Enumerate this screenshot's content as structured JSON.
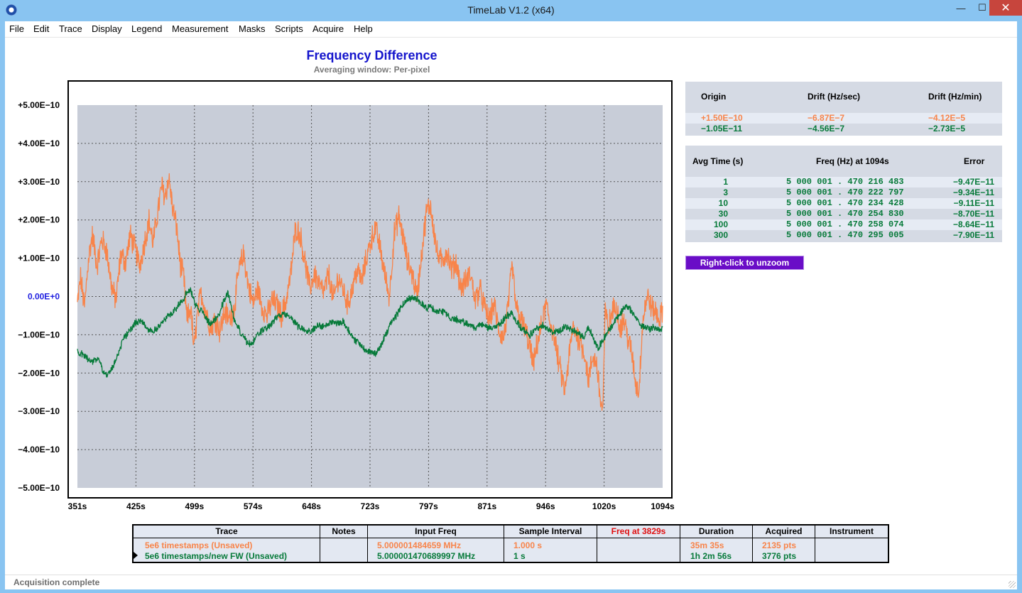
{
  "window": {
    "title": "TimeLab V1.2 (x64)",
    "min_glyph": "—",
    "max_glyph": "☐",
    "close_glyph": "✕"
  },
  "menu": [
    "File",
    "Edit",
    "Trace",
    "Display",
    "Legend",
    "Measurement",
    "Masks",
    "Scripts",
    "Acquire",
    "Help"
  ],
  "chart_title": "Frequency Difference",
  "chart_subtitle": "Averaging window: Per-pixel",
  "colors": {
    "series1": "#f8844a",
    "series2": "#077a3a",
    "plot_bg": "#c8cdd8",
    "zero_label": "#2020e0",
    "title": "#1414cc",
    "unzoom_bg": "#6a0dc7",
    "freq_header": "#e01010"
  },
  "chart_data": {
    "type": "line",
    "xlabel": "",
    "ylabel": "",
    "xlim": [
      351,
      1094
    ],
    "ylim": [
      -5e-10,
      5e-10
    ],
    "grid": true,
    "x_ticks": [
      "351s",
      "425s",
      "499s",
      "574s",
      "648s",
      "723s",
      "797s",
      "871s",
      "946s",
      "1020s",
      "1094s"
    ],
    "y_ticks": [
      "+5.00E−10",
      "+4.00E−10",
      "+3.00E−10",
      "+2.00E−10",
      "+1.00E−10",
      "0.00E+0",
      "−1.00E−10",
      "−2.00E−10",
      "−3.00E−10",
      "−4.00E−10",
      "−5.00E−10"
    ],
    "series": [
      {
        "name": "5e6 timestamps (Unsaved)",
        "color": "#f8844a",
        "noise": 0.28,
        "points": [
          [
            351,
            -0.2
          ],
          [
            355,
            0.5
          ],
          [
            360,
            -0.3
          ],
          [
            365,
            1.0
          ],
          [
            370,
            1.6
          ],
          [
            376,
            0.8
          ],
          [
            382,
            1.5
          ],
          [
            388,
            1.2
          ],
          [
            395,
            0.2
          ],
          [
            400,
            -0.1
          ],
          [
            406,
            1.1
          ],
          [
            412,
            0.9
          ],
          [
            418,
            1.6
          ],
          [
            425,
            1.2
          ],
          [
            430,
            0.8
          ],
          [
            436,
            1.4
          ],
          [
            442,
            2.0
          ],
          [
            447,
            1.4
          ],
          [
            453,
            2.2
          ],
          [
            458,
            2.9
          ],
          [
            462,
            2.6
          ],
          [
            467,
            3.1
          ],
          [
            472,
            2.3
          ],
          [
            477,
            1.8
          ],
          [
            482,
            0.8
          ],
          [
            486,
            0.5
          ],
          [
            490,
            -0.6
          ],
          [
            495,
            -0.3
          ],
          [
            499,
            -1.4
          ],
          [
            503,
            -0.5
          ],
          [
            508,
            0.1
          ],
          [
            514,
            -0.4
          ],
          [
            520,
            -0.8
          ],
          [
            526,
            -0.6
          ],
          [
            532,
            -0.9
          ],
          [
            538,
            -0.4
          ],
          [
            544,
            -0.6
          ],
          [
            550,
            -0.3
          ],
          [
            556,
            0.7
          ],
          [
            562,
            1.1
          ],
          [
            568,
            0.3
          ],
          [
            574,
            -0.2
          ],
          [
            580,
            0.2
          ],
          [
            586,
            -0.3
          ],
          [
            592,
            -0.5
          ],
          [
            598,
            -0.1
          ],
          [
            604,
            -0.2
          ],
          [
            610,
            -0.5
          ],
          [
            616,
            -0.1
          ],
          [
            622,
            0.6
          ],
          [
            628,
            1.8
          ],
          [
            634,
            1.6
          ],
          [
            640,
            0.9
          ],
          [
            646,
            0.2
          ],
          [
            652,
            0.6
          ],
          [
            658,
            0.3
          ],
          [
            664,
            0.1
          ],
          [
            670,
            0.6
          ],
          [
            676,
            -0.1
          ],
          [
            682,
            0.5
          ],
          [
            688,
            0.2
          ],
          [
            694,
            -0.2
          ],
          [
            700,
            0.2
          ],
          [
            706,
            0.7
          ],
          [
            712,
            0.4
          ],
          [
            718,
            1.0
          ],
          [
            723,
            1.4
          ],
          [
            729,
            1.8
          ],
          [
            735,
            1.3
          ],
          [
            741,
            0.6
          ],
          [
            747,
            0.0
          ],
          [
            753,
            1.6
          ],
          [
            759,
            2.1
          ],
          [
            765,
            1.5
          ],
          [
            770,
            0.9
          ],
          [
            776,
            0.6
          ],
          [
            782,
            0.0
          ],
          [
            788,
            1.1
          ],
          [
            794,
            2.2
          ],
          [
            799,
            2.4
          ],
          [
            803,
            1.8
          ],
          [
            808,
            1.1
          ],
          [
            814,
            0.9
          ],
          [
            820,
            1.2
          ],
          [
            826,
            0.7
          ],
          [
            832,
            0.9
          ],
          [
            838,
            0.2
          ],
          [
            844,
            0.4
          ],
          [
            850,
            0.6
          ],
          [
            856,
            -0.1
          ],
          [
            862,
            0.2
          ],
          [
            868,
            -0.3
          ],
          [
            874,
            -0.6
          ],
          [
            880,
            -0.2
          ],
          [
            886,
            -0.9
          ],
          [
            892,
            -1.1
          ],
          [
            897,
            -0.4
          ],
          [
            903,
            0.8
          ],
          [
            908,
            -0.3
          ],
          [
            914,
            -0.6
          ],
          [
            920,
            -0.9
          ],
          [
            925,
            -1.3
          ],
          [
            930,
            -1.8
          ],
          [
            935,
            -1.2
          ],
          [
            940,
            -0.8
          ],
          [
            946,
            -0.2
          ],
          [
            950,
            -0.6
          ],
          [
            955,
            -0.9
          ],
          [
            960,
            -1.5
          ],
          [
            965,
            -2.0
          ],
          [
            970,
            -2.5
          ],
          [
            975,
            -1.6
          ],
          [
            980,
            -0.8
          ],
          [
            985,
            -1.0
          ],
          [
            990,
            -1.2
          ],
          [
            995,
            -1.5
          ],
          [
            1000,
            -2.2
          ],
          [
            1005,
            -1.6
          ],
          [
            1010,
            -1.7
          ],
          [
            1015,
            -2.7
          ],
          [
            1018,
            -3.0
          ],
          [
            1021,
            -0.4
          ],
          [
            1025,
            -0.8
          ],
          [
            1030,
            -0.4
          ],
          [
            1035,
            -0.2
          ],
          [
            1040,
            -0.8
          ],
          [
            1045,
            -0.6
          ],
          [
            1050,
            -1.1
          ],
          [
            1055,
            -1.5
          ],
          [
            1060,
            -2.3
          ],
          [
            1064,
            -2.5
          ],
          [
            1068,
            -0.8
          ],
          [
            1072,
            -0.2
          ],
          [
            1076,
            0.0
          ],
          [
            1080,
            -0.3
          ],
          [
            1085,
            -0.4
          ],
          [
            1090,
            -0.6
          ],
          [
            1094,
            -0.4
          ]
        ]
      },
      {
        "name": "5e6 timestamps/new FW (Unsaved)",
        "color": "#077a3a",
        "noise": 0.08,
        "points": [
          [
            351,
            -1.45
          ],
          [
            360,
            -1.55
          ],
          [
            370,
            -1.7
          ],
          [
            378,
            -1.6
          ],
          [
            384,
            -2.0
          ],
          [
            390,
            -2.05
          ],
          [
            398,
            -1.75
          ],
          [
            404,
            -1.4
          ],
          [
            410,
            -1.1
          ],
          [
            418,
            -0.85
          ],
          [
            425,
            -0.7
          ],
          [
            432,
            -0.6
          ],
          [
            440,
            -0.85
          ],
          [
            448,
            -0.9
          ],
          [
            456,
            -0.75
          ],
          [
            462,
            -0.6
          ],
          [
            470,
            -0.45
          ],
          [
            478,
            -0.25
          ],
          [
            485,
            -0.1
          ],
          [
            490,
            0.1
          ],
          [
            494,
            0.2
          ],
          [
            499,
            -0.1
          ],
          [
            504,
            -0.35
          ],
          [
            510,
            -0.35
          ],
          [
            516,
            -0.65
          ],
          [
            522,
            -0.7
          ],
          [
            530,
            -0.5
          ],
          [
            537,
            -0.1
          ],
          [
            542,
            0.1
          ],
          [
            546,
            -0.2
          ],
          [
            550,
            -0.6
          ],
          [
            556,
            -0.85
          ],
          [
            562,
            -1.1
          ],
          [
            570,
            -1.25
          ],
          [
            574,
            -1.2
          ],
          [
            580,
            -1.0
          ],
          [
            588,
            -0.85
          ],
          [
            596,
            -0.75
          ],
          [
            604,
            -0.55
          ],
          [
            612,
            -0.45
          ],
          [
            620,
            -0.5
          ],
          [
            626,
            -0.65
          ],
          [
            632,
            -0.8
          ],
          [
            640,
            -0.85
          ],
          [
            648,
            -0.9
          ],
          [
            656,
            -0.75
          ],
          [
            664,
            -0.8
          ],
          [
            672,
            -0.65
          ],
          [
            680,
            -0.7
          ],
          [
            688,
            -0.65
          ],
          [
            696,
            -0.9
          ],
          [
            704,
            -1.15
          ],
          [
            712,
            -1.3
          ],
          [
            718,
            -1.4
          ],
          [
            723,
            -1.45
          ],
          [
            730,
            -1.5
          ],
          [
            736,
            -1.3
          ],
          [
            742,
            -1.0
          ],
          [
            748,
            -0.75
          ],
          [
            754,
            -0.55
          ],
          [
            760,
            -0.35
          ],
          [
            766,
            -0.15
          ],
          [
            772,
            -0.05
          ],
          [
            778,
            0.0
          ],
          [
            786,
            -0.15
          ],
          [
            794,
            -0.3
          ],
          [
            800,
            -0.3
          ],
          [
            808,
            -0.4
          ],
          [
            816,
            -0.4
          ],
          [
            824,
            -0.55
          ],
          [
            832,
            -0.6
          ],
          [
            840,
            -0.65
          ],
          [
            848,
            -0.75
          ],
          [
            856,
            -0.8
          ],
          [
            864,
            -0.75
          ],
          [
            871,
            -0.8
          ],
          [
            878,
            -0.85
          ],
          [
            886,
            -0.75
          ],
          [
            894,
            -0.55
          ],
          [
            902,
            -0.45
          ],
          [
            910,
            -0.7
          ],
          [
            918,
            -0.9
          ],
          [
            926,
            -1.0
          ],
          [
            934,
            -0.85
          ],
          [
            942,
            -0.75
          ],
          [
            946,
            -0.8
          ],
          [
            954,
            -0.95
          ],
          [
            962,
            -0.9
          ],
          [
            970,
            -0.8
          ],
          [
            978,
            -0.85
          ],
          [
            986,
            -0.95
          ],
          [
            994,
            -1.05
          ],
          [
            1000,
            -0.8
          ],
          [
            1006,
            -1.1
          ],
          [
            1012,
            -1.35
          ],
          [
            1018,
            -1.15
          ],
          [
            1024,
            -0.9
          ],
          [
            1030,
            -0.75
          ],
          [
            1036,
            -0.55
          ],
          [
            1042,
            -0.4
          ],
          [
            1048,
            -0.25
          ],
          [
            1054,
            -0.35
          ],
          [
            1060,
            -0.55
          ],
          [
            1066,
            -0.75
          ],
          [
            1072,
            -0.8
          ],
          [
            1078,
            -0.85
          ],
          [
            1084,
            -0.8
          ],
          [
            1090,
            -0.9
          ],
          [
            1094,
            -0.85
          ]
        ]
      }
    ]
  },
  "drift_panel": {
    "headers": [
      "Origin",
      "Drift (Hz/sec)",
      "Drift (Hz/min)"
    ],
    "rows": [
      [
        "+1.50E−10",
        "−6.87E−7",
        "−4.12E−5"
      ],
      [
        "−1.05E−11",
        "−4.56E−7",
        "−2.73E−5"
      ]
    ]
  },
  "avg_panel": {
    "headers": [
      "Avg Time (s)",
      "Freq (Hz) at 1094s",
      "Error"
    ],
    "rows": [
      [
        "1",
        "5 000 001 . 470 216 483",
        "−9.47E−11"
      ],
      [
        "3",
        "5 000 001 . 470 222 797",
        "−9.34E−11"
      ],
      [
        "10",
        "5 000 001 . 470 234 428",
        "−9.11E−11"
      ],
      [
        "30",
        "5 000 001 . 470 254 830",
        "−8.70E−11"
      ],
      [
        "100",
        "5 000 001 . 470 258 074",
        "−8.64E−11"
      ],
      [
        "300",
        "5 000 001 . 470 295 005",
        "−7.90E−11"
      ]
    ]
  },
  "unzoom_label": "Right-click to unzoom",
  "trace_table": {
    "headers": [
      "Trace",
      "Notes",
      "Input Freq",
      "Sample Interval",
      "Freq at 3829s",
      "Duration",
      "Acquired",
      "Instrument"
    ],
    "rows": [
      [
        "5e6 timestamps (Unsaved)",
        "",
        "5.000001484659 MHz",
        "1.000 s",
        "",
        "35m 35s",
        "2135 pts",
        ""
      ],
      [
        "5e6 timestamps/new FW (Unsaved)",
        "",
        "5.000001470689997 MHz",
        "1 s",
        "",
        "1h 2m 56s",
        "3776 pts",
        ""
      ]
    ]
  },
  "status": "Acquisition complete"
}
